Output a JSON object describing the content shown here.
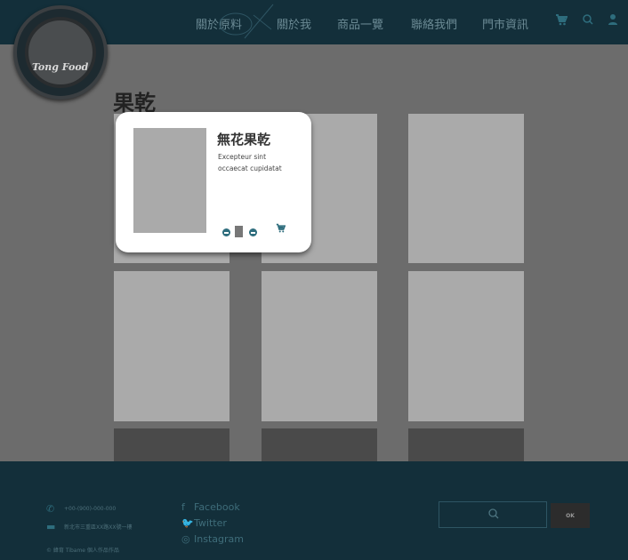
{
  "header": {
    "nav": [
      {
        "label": "關於原料"
      },
      {
        "label": "關於我"
      },
      {
        "label": "商品一覽"
      },
      {
        "label": "聯絡我們"
      },
      {
        "label": "門市資訊"
      }
    ],
    "icons": [
      "cart-icon",
      "search-icon",
      "user-icon"
    ]
  },
  "logo": {
    "text": "Tong Food"
  },
  "page": {
    "title": "果乾"
  },
  "popup": {
    "title": "無花果乾",
    "description": "Excepteur sint occaecat cupidatat"
  },
  "footer": {
    "phone": "+00-(900)-000-000",
    "address": "新北市三重區XX路XX號一樓",
    "copyright": "© 緯育 Tibame 個人作品作品",
    "social": [
      {
        "label": "Facebook",
        "icon": "facebook-icon"
      },
      {
        "label": "Twitter",
        "icon": "twitter-icon"
      },
      {
        "label": "Instagram",
        "icon": "instagram-icon"
      }
    ],
    "ok_label": "OK"
  },
  "colors": {
    "header_bg": "#132f3a",
    "overlay_bg": "#6c6c6c",
    "accent": "#2e6d7d",
    "card": "#aaaaaa"
  }
}
